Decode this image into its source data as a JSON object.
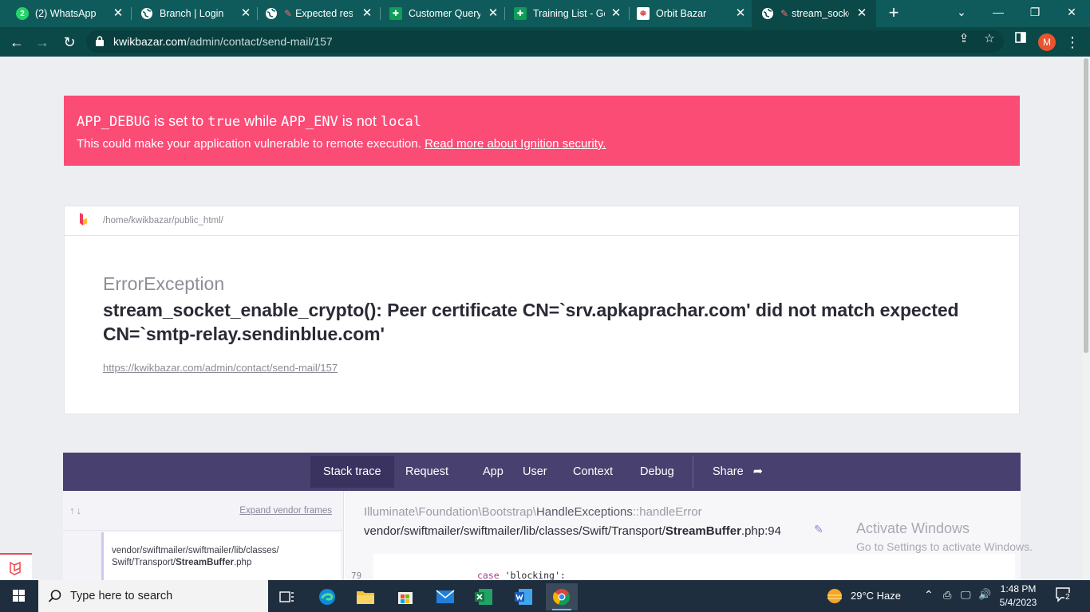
{
  "browser": {
    "tabs": [
      {
        "title": "(2) WhatsApp",
        "fav": "whatsapp-icon",
        "fav_text": "2",
        "fav_bg": "#25d366"
      },
      {
        "title": "Branch | Login",
        "fav": "globe-icon"
      },
      {
        "title": "Expected resp",
        "fav": "globe-icon"
      },
      {
        "title": "Customer Query",
        "fav": "sheets-icon"
      },
      {
        "title": "Training List - Go",
        "fav": "sheets-icon"
      },
      {
        "title": "Orbit Bazar",
        "fav": "orbit-bazar-icon"
      },
      {
        "title": "stream_socke",
        "fav": "globe-icon",
        "active": true
      }
    ],
    "url_domain": "kwikbazar.com",
    "url_path": "/admin/contact/send-mail/157",
    "profile_initial": "M",
    "colors": {
      "chrome": "#0f5b5b",
      "toolbar": "#0b4848",
      "profile": "#e8542f"
    }
  },
  "warning": {
    "part1_code": "APP_DEBUG",
    "part2": " is set to ",
    "part3_code": "true",
    "part4": " while ",
    "part5": "APP_ENV",
    "part6": " is not ",
    "part7_code": "local",
    "line2_text": "This could make your application vulnerable to remote execution. ",
    "line2_link": "Read more about Ignition security.",
    "color": "#fb4c76"
  },
  "error": {
    "path": "/home/kwikbazar/public_html/",
    "exception_class": "ErrorException",
    "message": "stream_socket_enable_crypto(): Peer certificate CN=`srv.apkaprachar.com' did not match expected CN=`smtp-relay.sendinblue.com'",
    "url": "https://kwikbazar.com/admin/contact/send-mail/157"
  },
  "panel_tabs": [
    "Stack trace",
    "Request",
    "App",
    "User",
    "Context",
    "Debug",
    "Share"
  ],
  "panel_color": "#48406f",
  "stack": {
    "expand_label": "Expand vendor frames",
    "frame_path_1": "vendor/swiftmailer/swiftmailer/lib/classes/",
    "frame_path_2": "Swift/Transport/",
    "frame_file": "StreamBuffer",
    "frame_ext": ".php",
    "code_class_prefix": "Illuminate\\Foundation\\Bootstrap\\",
    "code_class_name": "HandleExceptions",
    "code_class_method": "::handleError",
    "code_file_prefix": "vendor/swiftmailer/swiftmailer/lib/classes/Swift/Transport/",
    "code_file_name": "StreamBuffer",
    "code_file_suffix": ".php:94",
    "line_number": "79",
    "code_kw": "case",
    "code_str": " 'blocking':"
  },
  "watermark": {
    "line1": "Activate Windows",
    "line2": "Go to Settings to activate Windows."
  },
  "taskbar": {
    "search_placeholder": "Type here to search",
    "weather": "29°C  Haze",
    "time": "1:48 PM",
    "date": "5/4/2023",
    "notifications": "2"
  }
}
